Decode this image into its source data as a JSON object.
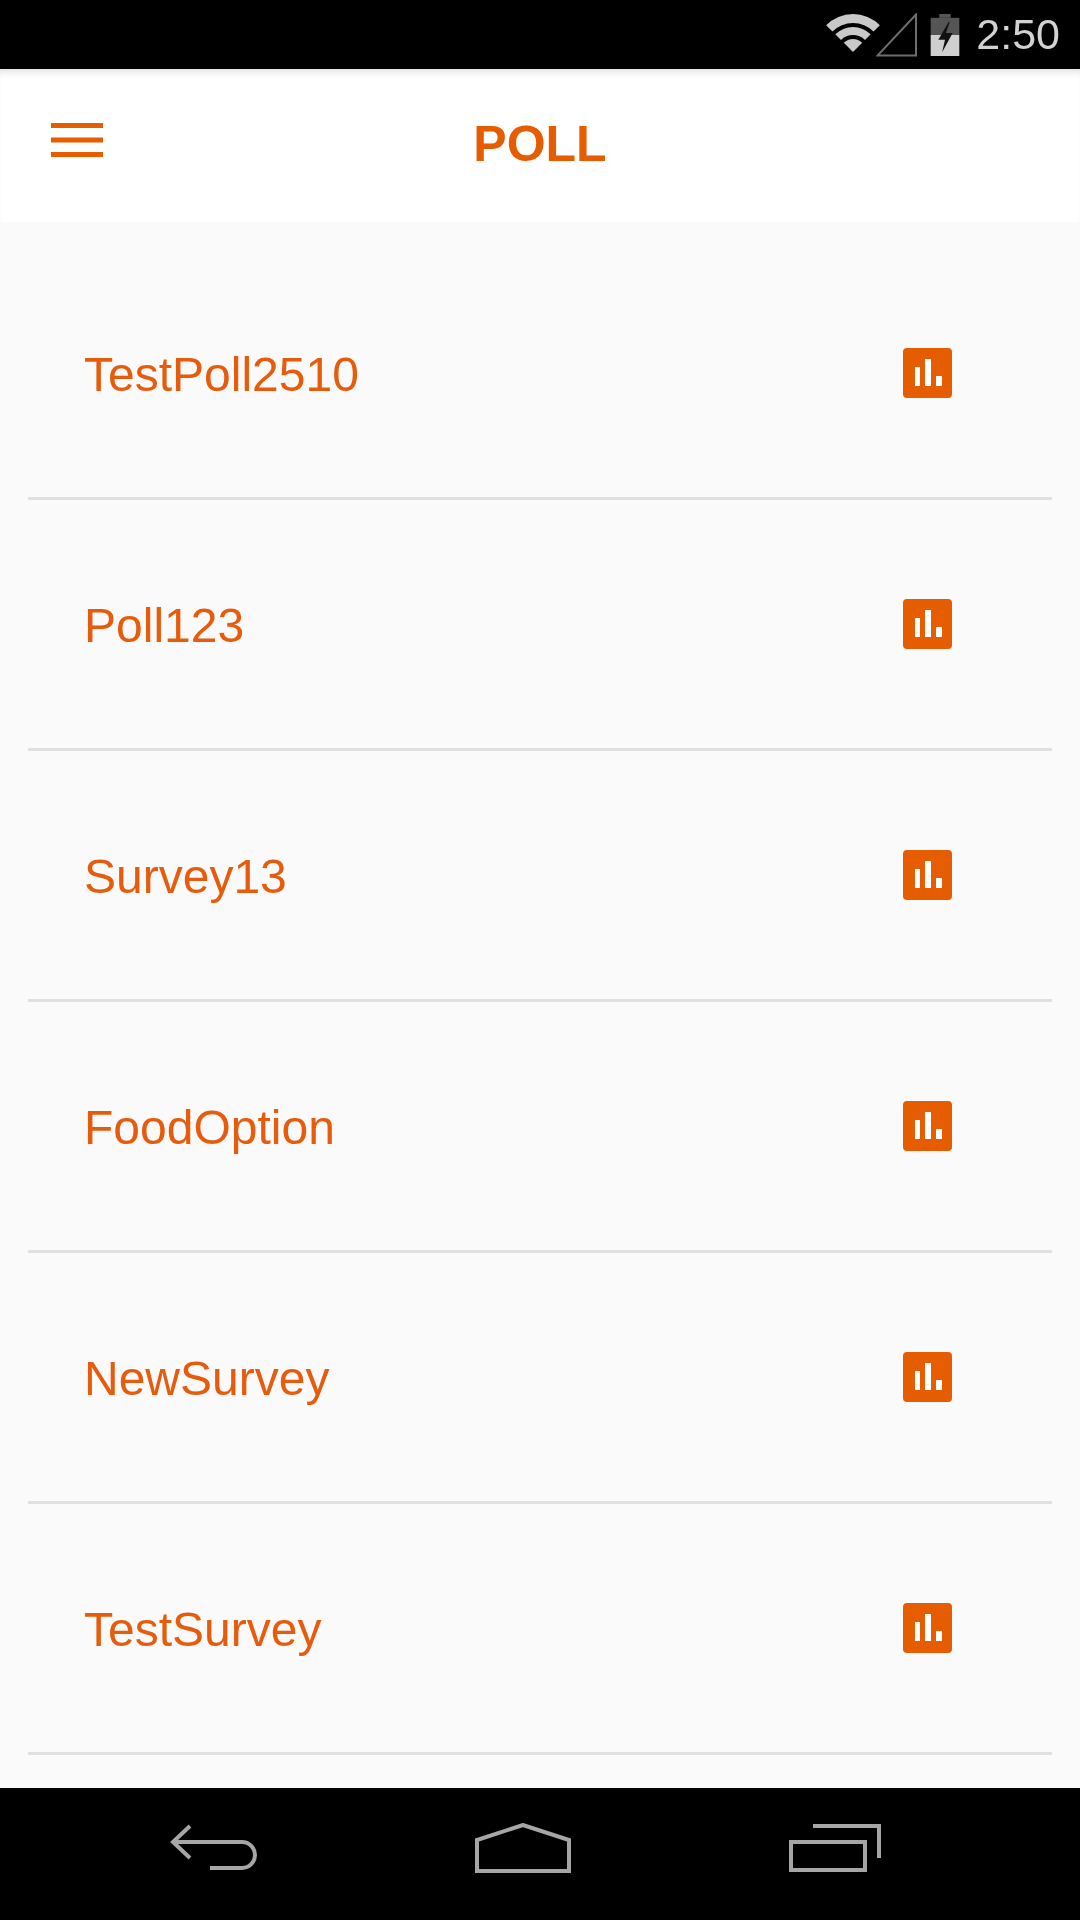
{
  "status_bar": {
    "time": "2:50"
  },
  "app_bar": {
    "title": "POLL"
  },
  "polls": [
    {
      "name": "TestPoll2510"
    },
    {
      "name": "Poll123"
    },
    {
      "name": "Survey13"
    },
    {
      "name": "FoodOption"
    },
    {
      "name": "NewSurvey"
    },
    {
      "name": "TestSurvey"
    }
  ]
}
